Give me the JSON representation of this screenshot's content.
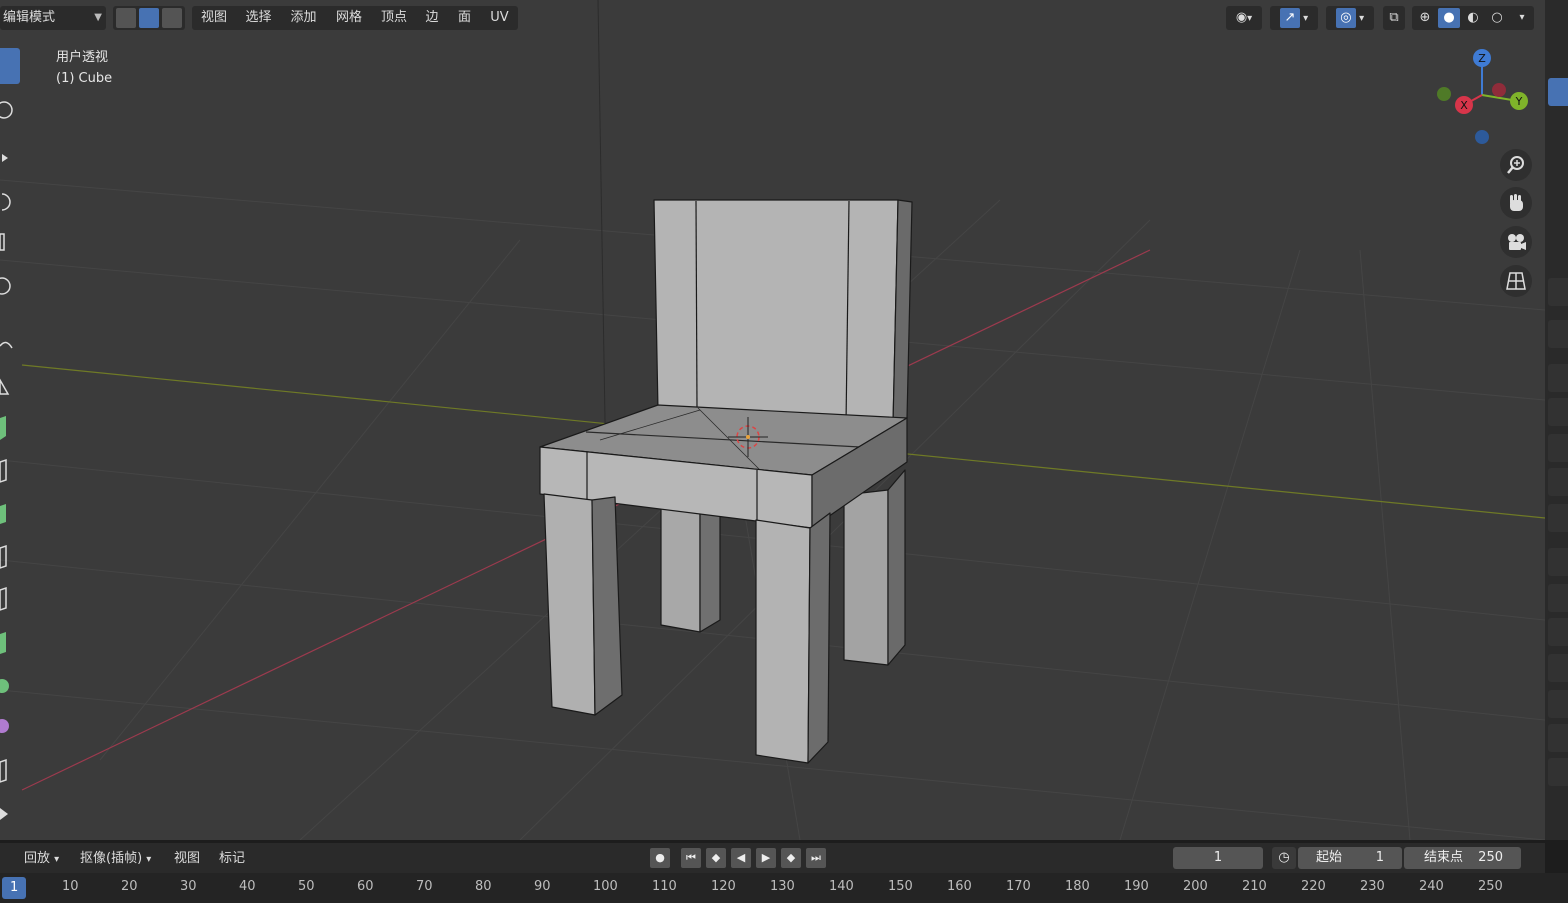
{
  "header": {
    "mode": "编辑模式",
    "menus": [
      "视图",
      "选择",
      "添加",
      "网格",
      "顶点",
      "边",
      "面",
      "UV"
    ]
  },
  "viewport": {
    "view_name": "用户透视",
    "object_name": "(1) Cube"
  },
  "gizmo": {
    "z": "Z",
    "y": "Y",
    "x": "X"
  },
  "timeline": {
    "playback": "回放",
    "keying": "抠像(插帧)",
    "view": "视图",
    "marker": "标记",
    "current_frame": "1",
    "start_label": "起始",
    "start_value": "1",
    "end_label": "结束点",
    "end_value": "250",
    "ruler": [
      "1",
      "10",
      "20",
      "30",
      "40",
      "50",
      "60",
      "70",
      "80",
      "90",
      "100",
      "110",
      "120",
      "130",
      "140",
      "150",
      "160",
      "170",
      "180",
      "190",
      "200",
      "210",
      "220",
      "230",
      "240",
      "250"
    ]
  },
  "colors": {
    "accent": "#4772b3",
    "viewport_bg": "#3b3b3b",
    "x_axis": "#9c3a4e",
    "y_axis": "#6f7a26",
    "mesh_face": "#a9a9a9"
  }
}
